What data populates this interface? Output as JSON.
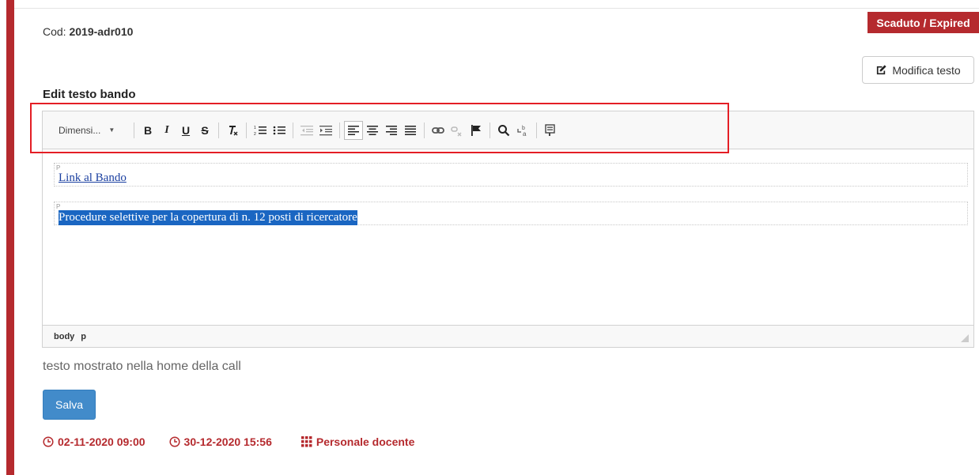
{
  "header": {
    "code_label": "Cod:",
    "code_value": "2019-adr010",
    "status_badge": "Scaduto / Expired",
    "modify_button": "Modifica testo"
  },
  "editor": {
    "section_title": "Edit testo bando",
    "toolbar": {
      "size_combo": "Dimensi...",
      "bold": "B",
      "italic": "I",
      "underline": "U",
      "strike": "S"
    },
    "paragraphs": [
      {
        "tag": "P",
        "text": "Link al Bando"
      },
      {
        "tag": "P",
        "text": "Procedure selettive per la copertura di n. 12 posti di ricercatore"
      }
    ],
    "path": [
      "body",
      "p"
    ]
  },
  "hint_text": "testo mostrato nella home della call",
  "save_button": "Salva",
  "meta": {
    "start_date": "02-11-2020 09:00",
    "end_date": "30-12-2020 15:56",
    "category": "Personale docente"
  },
  "colors": {
    "accent": "#b52a2e",
    "primary": "#428bca",
    "highlight": "#e41e25"
  }
}
